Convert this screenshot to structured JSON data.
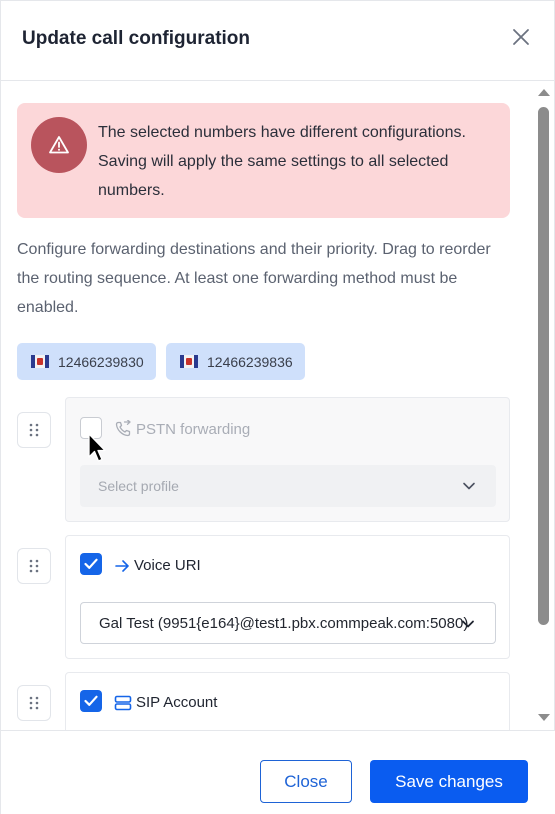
{
  "dialog": {
    "title": "Update call configuration"
  },
  "alert": {
    "text": "The selected numbers have different configurations. Saving will apply the same settings to all selected numbers.",
    "icon": "warning-icon",
    "bg_color": "#fcd7d9",
    "icon_color": "#b9545d"
  },
  "description": "Configure forwarding destinations and their priority. Drag to reorder the routing sequence. At least one forwarding method must be enabled.",
  "numbers": [
    "12466239830",
    "12466239836"
  ],
  "methods": [
    {
      "label": "PSTN forwarding",
      "icon": "phone-forward-icon",
      "checked": false,
      "select_value": "Select profile"
    },
    {
      "label": "Voice URI",
      "icon": "arrow-right-icon",
      "checked": true,
      "select_value": "Gal Test (9951{e164}@test1.pbx.commpeak.com:5080)"
    },
    {
      "label": "SIP Account",
      "icon": "server-icon",
      "checked": true
    }
  ],
  "footer": {
    "close_label": "Close",
    "save_label": "Save changes"
  },
  "colors": {
    "primary": "#0a5cf0",
    "chip_bg": "#cfe0fb"
  }
}
